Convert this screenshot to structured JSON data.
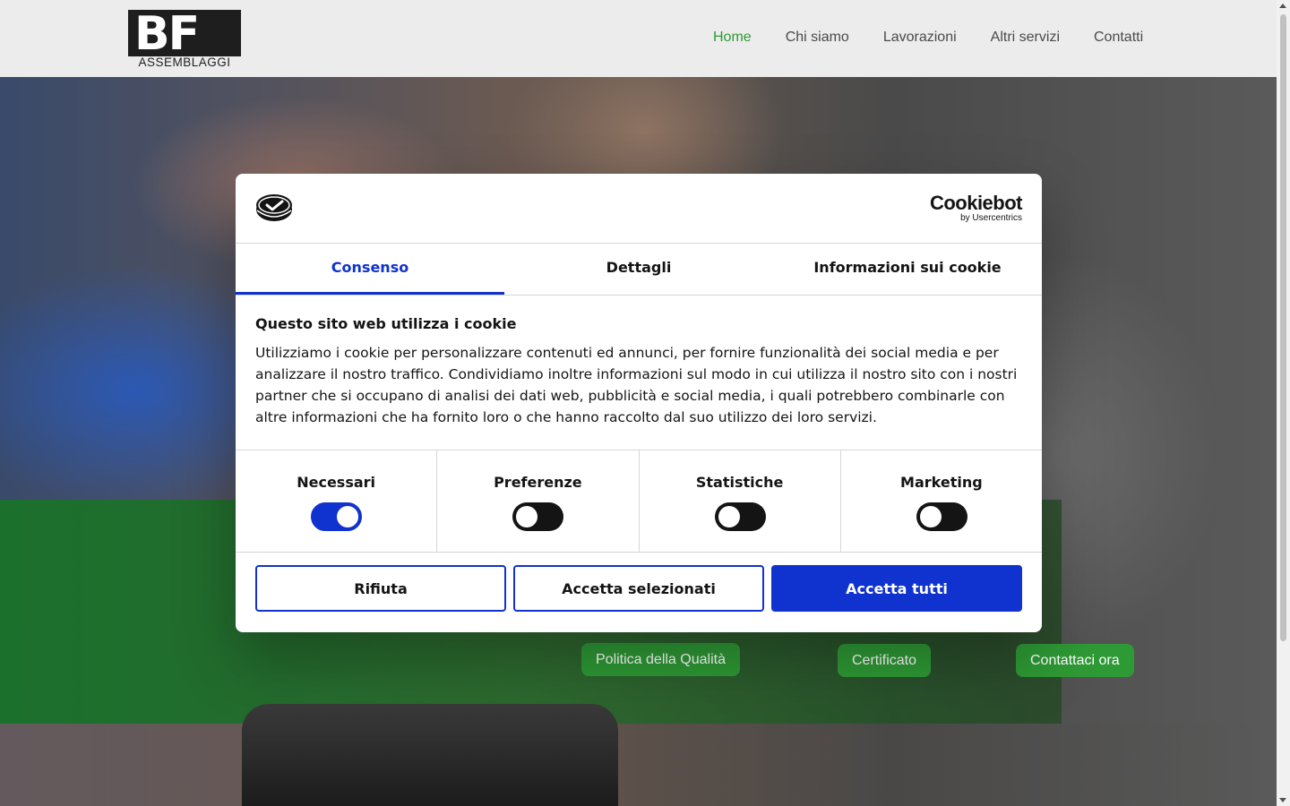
{
  "header": {
    "logo_letters": "BF",
    "logo_subtitle": "ASSEMBLAGGI",
    "nav": [
      {
        "label": "Home",
        "active": true
      },
      {
        "label": "Chi siamo"
      },
      {
        "label": "Lavorazioni"
      },
      {
        "label": "Altri servizi"
      },
      {
        "label": "Contatti"
      }
    ]
  },
  "hero": {
    "buttons": {
      "quality": "Politica della Qualità",
      "certificate": "Certificato",
      "contact": "Contattaci ora"
    },
    "accent_color": "#2e9a35"
  },
  "cookie_dialog": {
    "brand": {
      "name": "Cookiebot",
      "by": "by Usercentrics"
    },
    "tabs": [
      "Consenso",
      "Dettagli",
      "Informazioni sui cookie"
    ],
    "active_tab": "Consenso",
    "title": "Questo sito web utilizza i cookie",
    "text": "Utilizziamo i cookie per personalizzare contenuti ed annunci, per fornire funzionalità dei social media e per analizzare il nostro traffico. Condividiamo inoltre informazioni sul modo in cui utilizza il nostro sito con i nostri partner che si occupano di analisi dei dati web, pubblicità e social media, i quali potrebbero combinarle con altre informazioni che ha fornito loro o che hanno raccolto dal suo utilizzo dei loro servizi.",
    "categories": [
      {
        "label": "Necessari",
        "enabled": true
      },
      {
        "label": "Preferenze",
        "enabled": false
      },
      {
        "label": "Statistiche",
        "enabled": false
      },
      {
        "label": "Marketing",
        "enabled": false
      }
    ],
    "buttons": {
      "reject": "Rifiuta",
      "accept_selected": "Accetta selezionati",
      "accept_all": "Accetta tutti"
    },
    "accent_color": "#1032cf"
  }
}
